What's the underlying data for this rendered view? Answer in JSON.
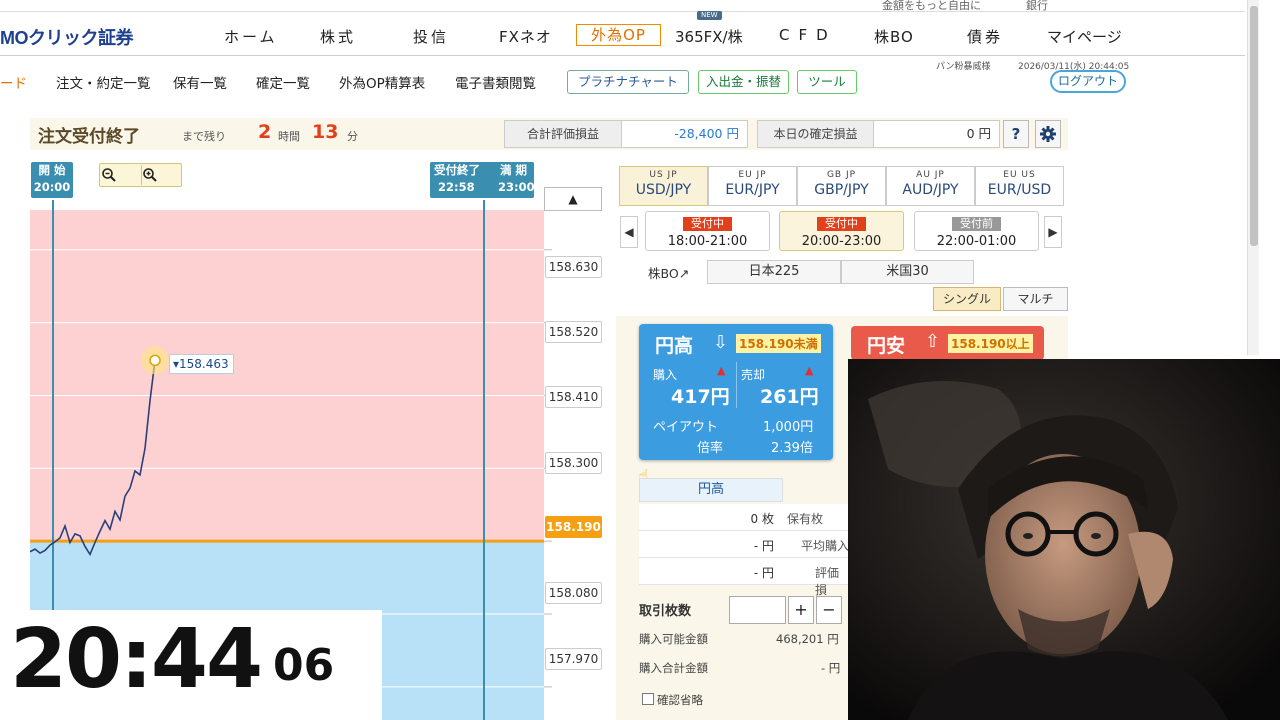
{
  "top_strip": {
    "left_text": "金額をもっと自由に",
    "right_text": "銀行"
  },
  "logo": "MOクリック証券",
  "nav": {
    "items": [
      "ホーム",
      "株式",
      "投信",
      "FXネオ",
      "外為OP",
      "365FX/株",
      "CFD",
      "株BO",
      "債券",
      "マイページ"
    ],
    "new_badge": "NEW"
  },
  "subnav": {
    "items": [
      "ード",
      "注文・約定一覧",
      "保有一覧",
      "確定一覧",
      "外為OP精算表",
      "電子書類閲覧"
    ],
    "buttons": [
      "プラチナチャート",
      "入出金・振替",
      "ツール"
    ],
    "logout": "ログアウト",
    "user": "パン粉暴威様",
    "datetime": "2026/03/11(水) 20:44:05"
  },
  "status": {
    "title": "注文受付終了",
    "remaining_label": "まで残り",
    "hours": "2",
    "hours_label": "時間",
    "minutes": "13",
    "minutes_label": "分",
    "pl_label": "合計評価損益",
    "pl_value": "-28,400 円",
    "confirmed_label": "本日の確定損益",
    "confirmed_value": "0 円",
    "help_icon": "?",
    "settings_icon": "gear"
  },
  "chart": {
    "start_flag": {
      "label": "開 始",
      "time": "20:00"
    },
    "end_flag": {
      "label": "受付終了",
      "time": "22:58"
    },
    "expiry_flag": {
      "label": "満 期",
      "time": "23:00"
    },
    "ticks": [
      "158.630",
      "158.520",
      "158.410",
      "158.300",
      "158.190",
      "158.080",
      "157.970"
    ],
    "current_price": "158.463",
    "strike": "158.190",
    "colors": {
      "up_zone": "#fdd0d2",
      "down_zone": "#b8e0f6",
      "strike": "#f5a014",
      "line": "#2b3f7a"
    }
  },
  "chart_data": {
    "type": "line",
    "x": [
      0,
      5,
      10,
      15,
      20,
      25,
      30,
      35,
      40,
      45,
      50,
      55,
      60,
      65,
      70,
      75,
      80,
      85,
      90,
      95,
      100,
      105,
      110,
      115,
      120,
      125
    ],
    "values": [
      158.174,
      158.178,
      158.172,
      158.176,
      158.184,
      158.189,
      158.195,
      158.213,
      158.188,
      158.201,
      158.198,
      158.182,
      158.17,
      158.188,
      158.205,
      158.221,
      158.208,
      158.235,
      158.222,
      158.258,
      158.27,
      158.296,
      158.29,
      158.33,
      158.402,
      158.463
    ],
    "ylim": [
      157.92,
      158.69
    ],
    "strike": 158.19
  },
  "clock": {
    "main": "20:44",
    "seconds": "06"
  },
  "pairs": [
    {
      "flags": "US JP",
      "name": "USD/JPY"
    },
    {
      "flags": "EU JP",
      "name": "EUR/JPY"
    },
    {
      "flags": "GB JP",
      "name": "GBP/JPY"
    },
    {
      "flags": "AU JP",
      "name": "AUD/JPY"
    },
    {
      "flags": "EU US",
      "name": "EUR/USD"
    }
  ],
  "sessions": [
    {
      "status": "受付中",
      "time": "18:00-21:00"
    },
    {
      "status": "受付中",
      "time": "20:00-23:00"
    },
    {
      "status": "受付前",
      "time": "22:00-01:00"
    }
  ],
  "kabu": {
    "label": "株BO↗",
    "buttons": [
      "日本225",
      "米国30"
    ]
  },
  "modes": [
    "シングル",
    "マルチ"
  ],
  "card_up": {
    "title": "円高",
    "condition": "158.190未満",
    "buy_label": "購入",
    "buy_price": "417円",
    "sell_label": "売却",
    "sell_price": "261円",
    "payout_label": "ペイアウト",
    "payout": "1,000円",
    "ratio_label": "倍率",
    "ratio": "2.39倍"
  },
  "card_down": {
    "title": "円安",
    "condition": "158.190以上"
  },
  "position_table": {
    "header": "円高",
    "rows": [
      {
        "value": "0 枚",
        "label": "保有枚"
      },
      {
        "value": "- 円",
        "label": "平均購入"
      },
      {
        "value": "- 円",
        "label": "評価損"
      }
    ]
  },
  "order": {
    "qty_label": "取引枚数",
    "qty_value": "",
    "plus": "+",
    "minus": "−",
    "available_label": "購入可能金額",
    "available_value": "468,201 円",
    "total_label": "購入合計金額",
    "total_value": "- 円",
    "confirm_skip": "確認省略"
  }
}
